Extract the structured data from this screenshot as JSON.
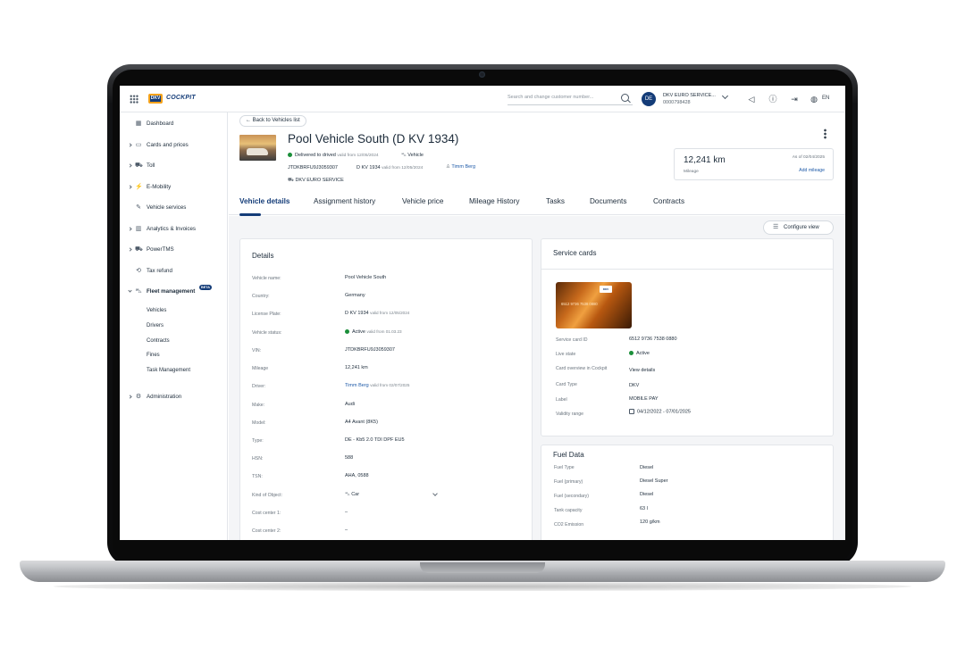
{
  "topbar": {
    "logo": "DKV",
    "logo_text": "COCKPIT",
    "search_placeholder": "Search and change customer number...",
    "avatar": "DE",
    "account_name": "DKV EURO SERVICE...",
    "account_number": "0000798428",
    "language": "EN"
  },
  "sidebar": {
    "items": [
      {
        "label": "Dashboard",
        "icon": "dashboard-icon",
        "glyph": "▦"
      },
      {
        "label": "Cards and prices",
        "icon": "cards-icon",
        "glyph": "▭"
      },
      {
        "label": "Toll",
        "icon": "toll-icon",
        "glyph": "⛟"
      },
      {
        "label": "E-Mobility",
        "icon": "plug-icon",
        "glyph": "⚡"
      },
      {
        "label": "Vehicle services",
        "icon": "wrench-icon",
        "glyph": "✎"
      },
      {
        "label": "Analytics & Invoices",
        "icon": "analytics-icon",
        "glyph": "▥"
      },
      {
        "label": "PowerTMS",
        "icon": "truck-icon",
        "glyph": "⛟"
      },
      {
        "label": "Tax refund",
        "icon": "tax-icon",
        "glyph": "⟲"
      },
      {
        "label": "Fleet management",
        "icon": "fleet-icon",
        "glyph": "⛍",
        "badge": "BETA"
      },
      {
        "label": "Administration",
        "icon": "admin-icon",
        "glyph": "⚙"
      }
    ],
    "fleet_subitems": [
      "Vehicles",
      "Drivers",
      "Contracts",
      "Fines",
      "Task Management"
    ]
  },
  "header": {
    "back_label": "Back to Vehicles list",
    "title": "Pool Vehicle South (D KV 1934)",
    "status": "Delivered to drived",
    "status_valid": "valid from 12/05/2024",
    "vehicle_type": "Vehicle",
    "vin": "JTDKBRFU9J3059307",
    "plate": "D KV 1934",
    "plate_valid": "valid from 12/05/2024",
    "driver": "Timm Berg",
    "company": "DKV EURO SERVICE",
    "mileage_value": "12,241 km",
    "mileage_label": "Mileage",
    "mileage_asof": "As of 02/04/2025",
    "add_mileage": "Add mileage"
  },
  "tabs": [
    "Vehicle details",
    "Assignment history",
    "Vehicle price",
    "Mileage History",
    "Tasks",
    "Documents",
    "Contracts"
  ],
  "configure_view": "Configure view",
  "details": {
    "title": "Details",
    "rows": [
      {
        "label": "Vehicle name:",
        "value": "Pool Vehicle South",
        "extra": ""
      },
      {
        "label": "Country:",
        "value": "Germany",
        "extra": ""
      },
      {
        "label": "License Plate:",
        "value": "D KV 1934",
        "extra": "valid from 12/05/2024"
      },
      {
        "label": "Vehicle status:",
        "value": "Active",
        "extra": "valid from 01.03.23"
      },
      {
        "label": "VIN:",
        "value": "JTDKBRFU9J3059307",
        "extra": ""
      },
      {
        "label": "Mileage",
        "value": "12,241 km",
        "extra": ""
      },
      {
        "label": "Driver:",
        "value": "Timm Berg",
        "extra": "valid from 02/07/2025"
      },
      {
        "label": "Make:",
        "value": "Audi",
        "extra": ""
      },
      {
        "label": "Model:",
        "value": "A4 Avant (8K5)",
        "extra": ""
      },
      {
        "label": "Type:",
        "value": "DE - Kb5 2.0 TDI DPF EU5",
        "extra": ""
      },
      {
        "label": "HSN:",
        "value": "588",
        "extra": ""
      },
      {
        "label": "TSN:",
        "value": "AHA, 0588",
        "extra": ""
      },
      {
        "label": "Kind of Object:",
        "value": "Car",
        "extra": ""
      },
      {
        "label": "Cost center 1:",
        "value": "–",
        "extra": ""
      },
      {
        "label": "Cost center 2:",
        "value": "–",
        "extra": ""
      }
    ]
  },
  "service_cards": {
    "title": "Service cards",
    "card_logo": "DKV",
    "card_number_print": "6512 9736 7538 0880",
    "rows": [
      {
        "label": "Service card ID",
        "value": "6512 9736 7538 0880"
      },
      {
        "label": "Live state",
        "value": "Active"
      },
      {
        "label": "Card overview in Cockpit",
        "value": "View details"
      },
      {
        "label": "Card Type",
        "value": "DKV"
      },
      {
        "label": "Label",
        "value": "MOBILE PAY"
      },
      {
        "label": "Validity range",
        "value": "04/12/2022 - 07/01/2025"
      }
    ]
  },
  "fuel_data": {
    "title": "Fuel Data",
    "rows": [
      {
        "label": "Fuel Type",
        "value": "Diesel"
      },
      {
        "label": "Fuel (primary)",
        "value": "Diesel Super"
      },
      {
        "label": "Fuel (secondary)",
        "value": "Diesel"
      },
      {
        "label": "Tank capacity",
        "value": "63 l"
      },
      {
        "label": "CO2 Emission",
        "value": "120 g/km"
      }
    ]
  },
  "colors": {
    "brand_blue": "#143c78",
    "brand_orange": "#f4a21b",
    "status_green": "#1b8f3a",
    "link": "#1e5aa8"
  }
}
